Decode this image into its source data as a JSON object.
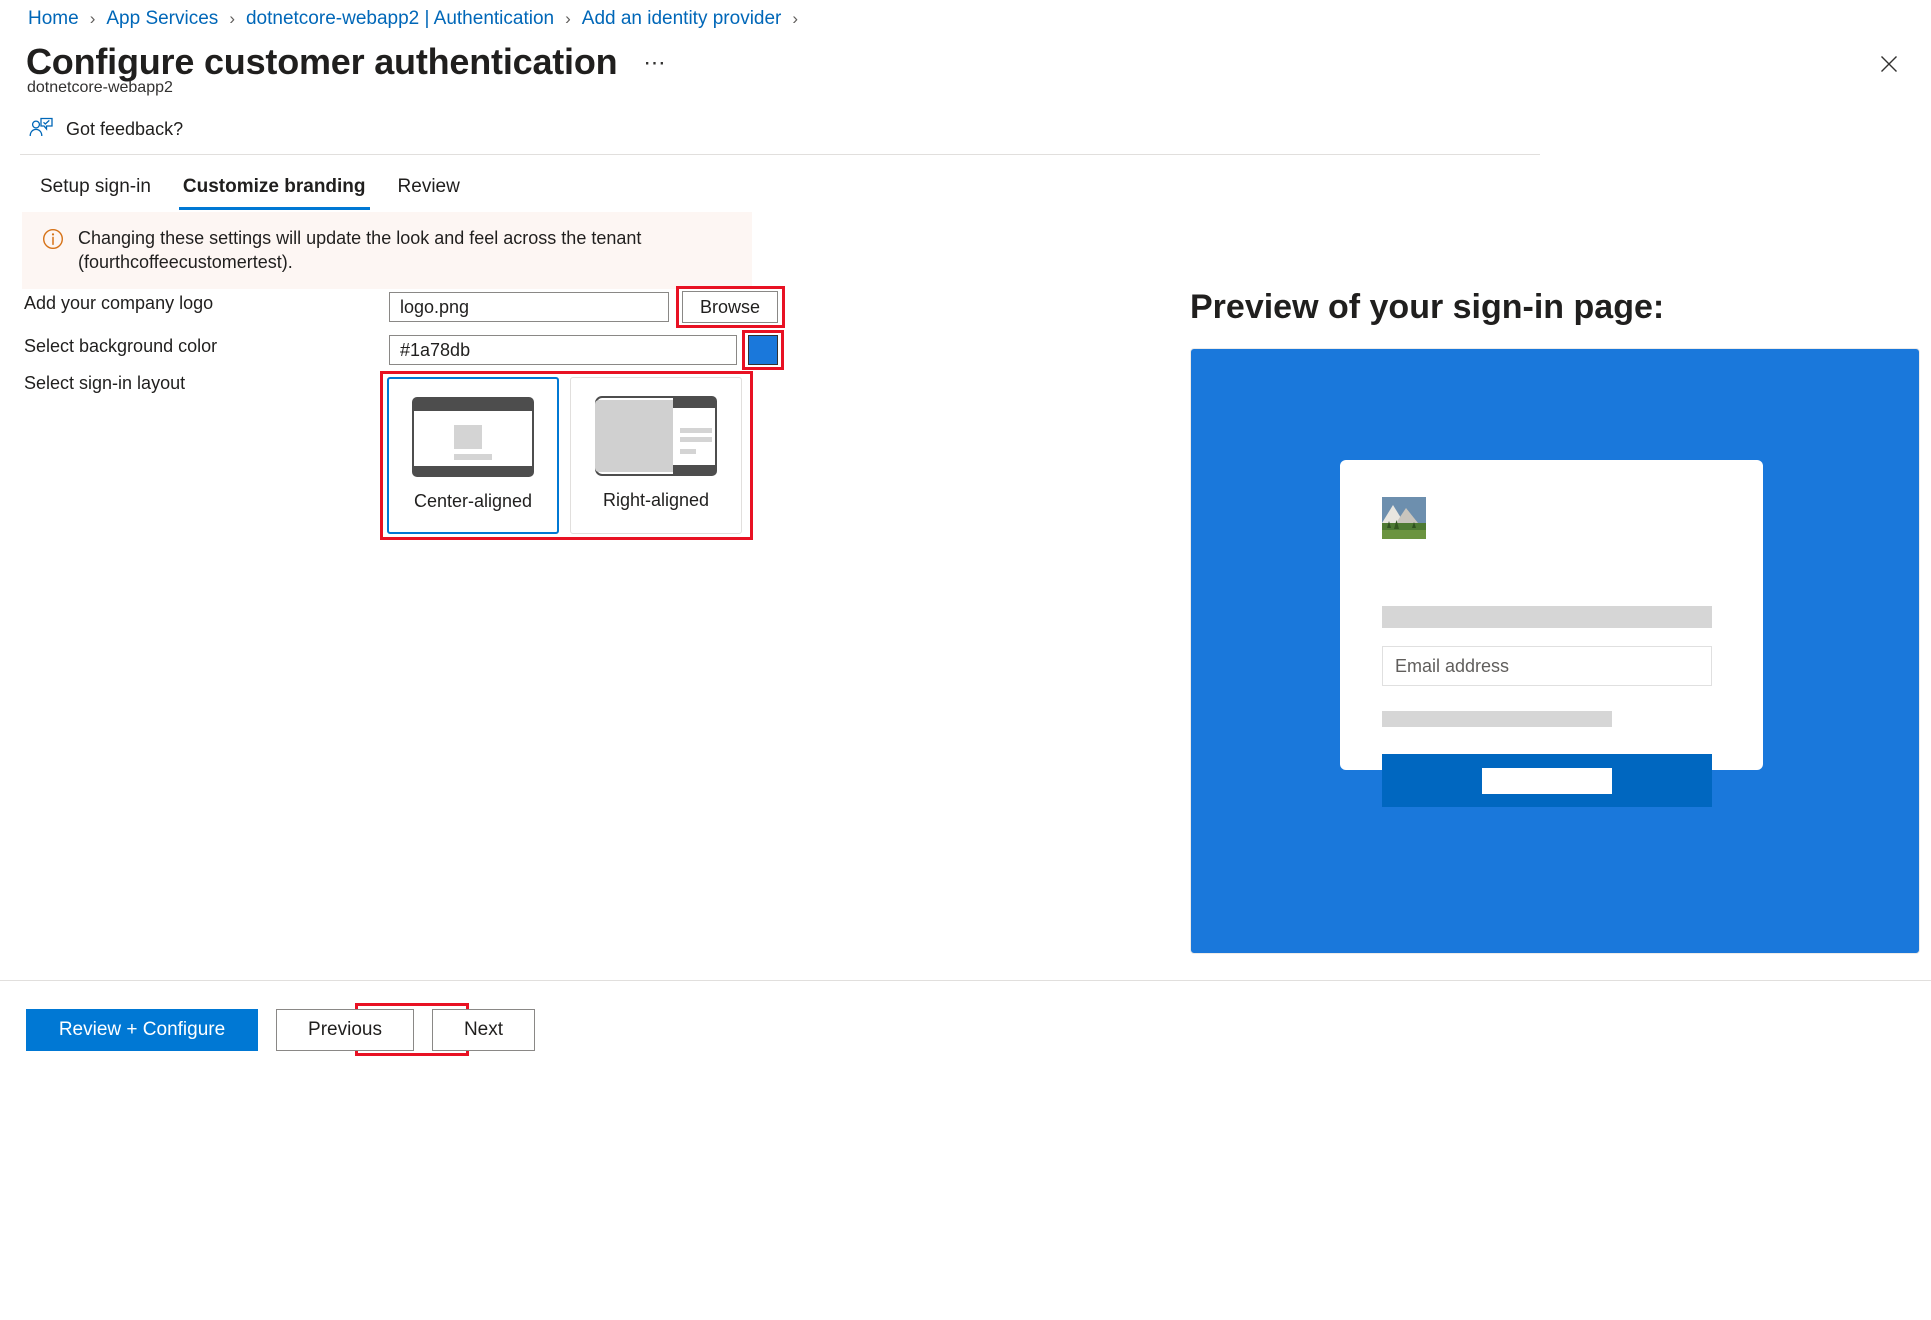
{
  "breadcrumb": {
    "items": [
      {
        "label": "Home"
      },
      {
        "label": "App Services"
      },
      {
        "label": "dotnetcore-webapp2 | Authentication"
      },
      {
        "label": "Add an identity provider"
      }
    ],
    "separator": "›"
  },
  "header": {
    "title": "Configure customer authentication",
    "ellipsis": "⋯",
    "subtitle": "dotnetcore-webapp2",
    "close_icon": "close-icon"
  },
  "feedback": {
    "label": "Got feedback?",
    "icon": "feedback-person-icon"
  },
  "tabs": [
    {
      "label": "Setup sign-in",
      "active": false
    },
    {
      "label": "Customize branding",
      "active": true
    },
    {
      "label": "Review",
      "active": false
    }
  ],
  "info_banner": {
    "icon": "info-circle-icon",
    "text": "Changing these settings will update the look and feel across the tenant (fourthcoffeecustomertest).",
    "background": "#fdf6f3",
    "icon_color": "#d67217"
  },
  "form": {
    "logo": {
      "label": "Add your company logo",
      "value": "logo.png",
      "placeholder": "",
      "browse_label": "Browse"
    },
    "background_color": {
      "label": "Select background color",
      "value": "#1a78db",
      "placeholder": "",
      "swatch_color": "#1a78db"
    },
    "layout": {
      "label": "Select sign-in layout",
      "options": [
        {
          "label": "Center-aligned",
          "selected": true
        },
        {
          "label": "Right-aligned",
          "selected": false
        }
      ]
    }
  },
  "preview": {
    "title": "Preview of your sign-in page:",
    "background_color": "#1a78db",
    "logo_alt": "company-logo-thumbnail",
    "email_placeholder": "Email address",
    "button_color": "#0067c0"
  },
  "footer": {
    "review_configure_label": "Review + Configure",
    "previous_label": "Previous",
    "next_label": "Next"
  },
  "annotations": {
    "highlight_color": "#e81123",
    "boxes": [
      "browse-button",
      "color-swatch",
      "layout-selector",
      "next-button"
    ]
  },
  "colors": {
    "accent": "#0078d4",
    "link": "#0067b8",
    "text": "#201f1e",
    "border": "#8a8886"
  }
}
